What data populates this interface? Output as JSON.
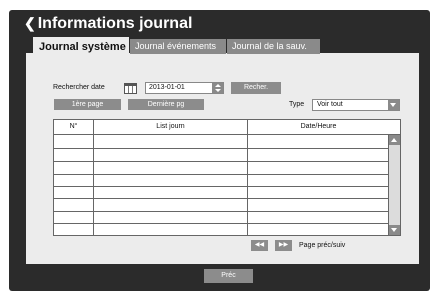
{
  "window": {
    "title": "Informations journal"
  },
  "tabs": [
    {
      "label": "Journal système",
      "active": true
    },
    {
      "label": "Journal événements",
      "active": false
    },
    {
      "label": "Journal de la sauv.",
      "active": false
    }
  ],
  "search": {
    "label": "Rechercher date",
    "date_value": "2013-01-01",
    "search_button": "Recher.",
    "calendar_icon": "calendar-icon"
  },
  "nav": {
    "first_page": "1ère page",
    "last_page": "Dernière pg"
  },
  "type_filter": {
    "label": "Type",
    "selected": "Voir tout"
  },
  "table": {
    "columns": [
      "N°",
      "List journ",
      "Date/Heure"
    ],
    "rows": [
      [
        "",
        "",
        ""
      ],
      [
        "",
        "",
        ""
      ],
      [
        "",
        "",
        ""
      ],
      [
        "",
        "",
        ""
      ],
      [
        "",
        "",
        ""
      ],
      [
        "",
        "",
        ""
      ],
      [
        "",
        "",
        ""
      ],
      [
        "",
        "",
        ""
      ]
    ]
  },
  "pager": {
    "prev_icon": "double-left-arrow-icon",
    "next_icon": "double-right-arrow-icon",
    "label": "Page préc/suiv"
  },
  "footer": {
    "back_button": "Préc"
  },
  "colors": {
    "frame": "#2b2b2b",
    "panel": "#ececec",
    "button": "#8c8c8c"
  }
}
